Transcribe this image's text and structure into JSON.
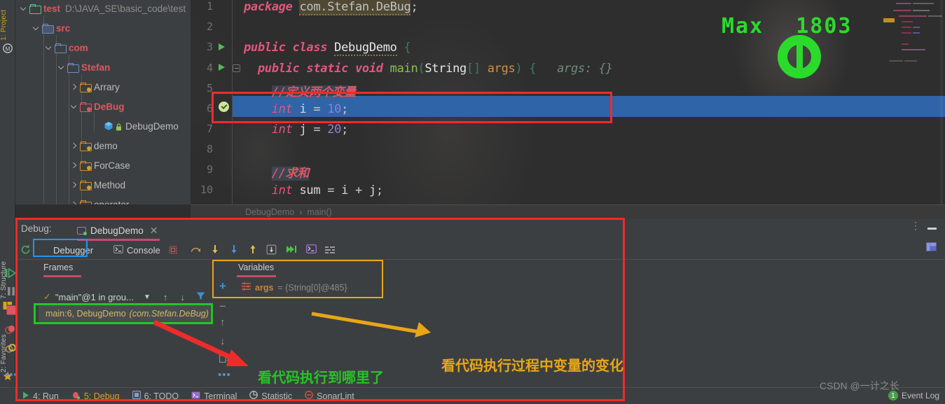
{
  "left_tool_strip": {
    "tabs": [
      {
        "label": "1: Project",
        "icon": "project-icon"
      },
      {
        "label": "7: Structure",
        "icon": "structure-icon"
      },
      {
        "label": "2: Favorites",
        "icon": "star-icon"
      }
    ]
  },
  "project_tree": {
    "rows": [
      {
        "label": "test",
        "path": "D:\\JAVA_SE\\basic_code\\test",
        "icon": "folder-green",
        "expanded": true,
        "indent": 0
      },
      {
        "label": "src",
        "path": "",
        "icon": "folder-src",
        "expanded": true,
        "indent": 1
      },
      {
        "label": "com",
        "path": "",
        "icon": "folder-blue",
        "expanded": true,
        "indent": 2
      },
      {
        "label": "Stefan",
        "path": "",
        "icon": "folder-blue",
        "expanded": true,
        "indent": 3
      },
      {
        "label": "Arrary",
        "path": "",
        "icon": "folder-orange",
        "expanded": false,
        "indent": 4
      },
      {
        "label": "DeBug",
        "path": "",
        "icon": "folder-red",
        "expanded": true,
        "indent": 4
      },
      {
        "label": "DebugDemo",
        "path": "",
        "icon": "java-class",
        "expanded": null,
        "indent": 5
      },
      {
        "label": "demo",
        "path": "",
        "icon": "folder-orange",
        "expanded": false,
        "indent": 4
      },
      {
        "label": "ForCase",
        "path": "",
        "icon": "folder-orange",
        "expanded": false,
        "indent": 4
      },
      {
        "label": "Method",
        "path": "",
        "icon": "folder-orange",
        "expanded": false,
        "indent": 4
      },
      {
        "label": "operator",
        "path": "",
        "icon": "folder-orange",
        "expanded": false,
        "indent": 4
      }
    ]
  },
  "editor": {
    "line_numbers": [
      "1",
      "2",
      "3",
      "4",
      "5",
      "6",
      "7",
      "8",
      "9",
      "10"
    ],
    "lines": [
      "package com.Stefan.DeBug;",
      "",
      "public class DebugDemo {",
      "    public static void main(String[] args) {   args: {}",
      "        //定义两个变量",
      "        int i = 10;",
      "        int j = 20;",
      "",
      "        //求和",
      "        int sum = i + j;"
    ],
    "highlighted_line": 6,
    "breakpoint_line": 6,
    "param_hint": "args: {}",
    "breadcrumb": [
      "DebugDemo",
      "main()"
    ]
  },
  "overlay": {
    "max_label": "Max",
    "max_value": "1803"
  },
  "debug_panel": {
    "title": "Debug:",
    "session_name": "DebugDemo",
    "tabs": [
      {
        "label": "Debugger",
        "icon": "debugger-icon",
        "active": true
      },
      {
        "label": "Console",
        "icon": "console-icon",
        "active": false
      }
    ],
    "toolbar_icons": [
      "rerun-icon",
      "camera-icon",
      "step-over-icon",
      "step-into-icon",
      "force-step-into-icon",
      "step-out-icon",
      "drop-frame-icon",
      "run-to-cursor-icon",
      "evaluate-icon",
      "settings-layout-icon"
    ],
    "side_icons": [
      "resume-icon",
      "pause-icon",
      "stop-icon",
      "view-breakpoints-icon",
      "mute-breakpoints-icon",
      "more-icon"
    ],
    "frames": {
      "header": "Frames",
      "thread": "\"main\"@1 in grou...",
      "items": [
        {
          "label": "main:6, DebugDemo",
          "detail": "(com.Stefan.DeBug)"
        }
      ]
    },
    "variables": {
      "header": "Variables",
      "items": [
        {
          "name": "args",
          "value": "= {String[0]@485}"
        }
      ]
    },
    "header_icons": [
      "more-vertical-icon",
      "minimize-icon",
      "layout-settings-icon"
    ]
  },
  "annotations": {
    "yellow_note": "看代码执行过程中变量的变化",
    "green_note": "看代码执行到哪里了",
    "colors": {
      "red": "#ef2b2b",
      "blue": "#2196f3",
      "green": "#25c425",
      "yellow": "#e8a617"
    }
  },
  "status_bar": {
    "items": [
      {
        "label": "4: Run",
        "icon": "run-icon",
        "active": false
      },
      {
        "label": "5: Debug",
        "icon": "debug-icon",
        "active": true
      },
      {
        "label": "6: TODO",
        "icon": "todo-icon",
        "active": false
      },
      {
        "label": "Terminal",
        "icon": "terminal-icon",
        "active": false
      },
      {
        "label": "Statistic",
        "icon": "statistic-icon",
        "active": false
      },
      {
        "label": "SonarLint",
        "icon": "sonarlint-icon",
        "active": false
      }
    ],
    "event_log": "Event Log",
    "event_log_count": "1"
  },
  "watermark": "CSDN @一计之长"
}
